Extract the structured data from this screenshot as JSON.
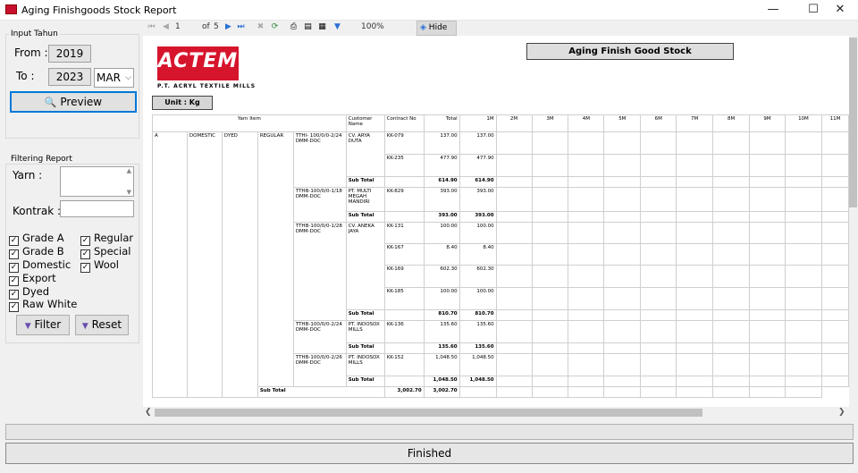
{
  "window": {
    "title": "Aging Finishgoods Stock Report",
    "min_glyph": "—",
    "max_glyph": "☐",
    "close_glyph": "✕"
  },
  "left": {
    "input_tahun": "Input Tahun",
    "from_label": "From :",
    "from_year": "2019",
    "to_label": "To :",
    "to_year": "2023",
    "month": "MAR",
    "preview": "Preview",
    "filtering": "Filtering Report",
    "yarn_label": "Yarn :",
    "kontrak_label": "Kontrak :",
    "checkboxes": [
      {
        "label": "Grade A",
        "checked": true
      },
      {
        "label": "Grade B",
        "checked": true
      },
      {
        "label": "Domestic",
        "checked": true
      },
      {
        "label": "Export",
        "checked": true
      },
      {
        "label": "Dyed",
        "checked": true
      },
      {
        "label": "Raw White",
        "checked": true
      },
      {
        "label": "Regular",
        "checked": true
      },
      {
        "label": "Special",
        "checked": true
      },
      {
        "label": "Wool",
        "checked": true
      }
    ],
    "filter": "Filter",
    "reset": "Reset"
  },
  "toolbar": {
    "page": "1",
    "of": "of",
    "total": "5",
    "zoom": "100%",
    "hide": "Hide"
  },
  "report": {
    "logo": "ACTEM",
    "company": "P.T. ACRYL TEXTILE MILLS",
    "title": "Aging Finish Good Stock",
    "unit": "Unit : Kg",
    "headers": [
      "Yarn Item",
      "Customer Name",
      "Contract No",
      "Total",
      "1M",
      "2M",
      "3M",
      "4M",
      "5M",
      "6M",
      "7M",
      "8M",
      "9M",
      "10M",
      "11M"
    ],
    "row_grade": "A",
    "row_market": "DOMESTIC",
    "row_type": "DYED",
    "row_class": "REGULAR",
    "rows": [
      [
        "TTHI- 100/0/0-2/24 DMM-DOC",
        "CV. ARYA DUTA",
        "KK-079",
        "137.00",
        "137.00"
      ],
      [
        "",
        "",
        "KK-235",
        "477.90",
        "477.90"
      ],
      [
        "",
        "Sub Total",
        "",
        "614.90",
        "614.90"
      ],
      [
        "TTHB-100/0/0-1/18 DMM-DOC",
        "PT. MULTI MEGAH MANDIRI",
        "KK-829",
        "393.00",
        "393.00"
      ],
      [
        "",
        "Sub Total",
        "",
        "393.00",
        "393.00"
      ],
      [
        "TTHB-100/0/0-1/28 DMM-DOC",
        "CV. ANEKA JAYA",
        "KK-131",
        "100.00",
        "100.00"
      ],
      [
        "",
        "",
        "KK-167",
        "8.40",
        "8.40"
      ],
      [
        "",
        "",
        "KK-169",
        "602.30",
        "602.30"
      ],
      [
        "",
        "",
        "KK-185",
        "100.00",
        "100.00"
      ],
      [
        "",
        "Sub Total",
        "",
        "810.70",
        "810.70"
      ],
      [
        "TTHB-100/0/0-2/24 DMM-DOC",
        "PT. INDOSOX MILLS",
        "KK-136",
        "135.60",
        "135.60"
      ],
      [
        "",
        "Sub Total",
        "",
        "135.60",
        "135.60"
      ],
      [
        "TTHB-100/0/0-2/26 DMM-DOC",
        "PT. INDOSOX MILLS",
        "KK-152",
        "1,048.50",
        "1,048.50"
      ],
      [
        "",
        "Sub Total",
        "",
        "1,048.50",
        "1,048.50"
      ],
      [
        "Sub Total",
        "",
        "",
        "3,002.70",
        "3,002.70"
      ]
    ]
  },
  "status": {
    "finished": "Finished"
  }
}
